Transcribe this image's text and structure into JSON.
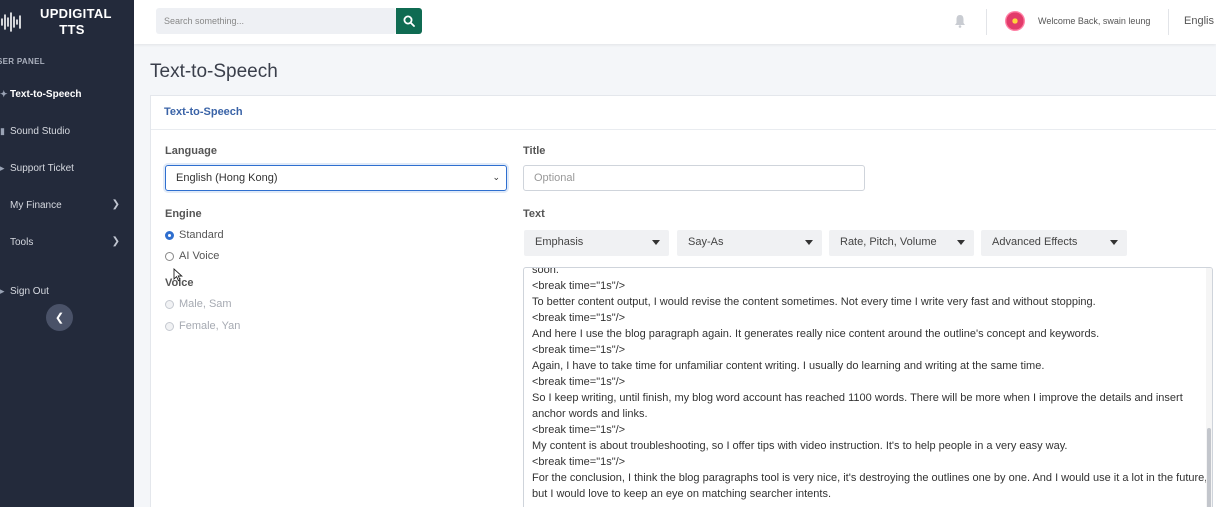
{
  "brand": {
    "line1": "UPDIGITAL",
    "line2": "TTS"
  },
  "sidebar": {
    "panel_label": "SER PANEL",
    "items": [
      {
        "label": "Text-to-Speech",
        "icon": "microphone-icon"
      },
      {
        "label": "Sound Studio",
        "icon": "studio-icon"
      },
      {
        "label": "Support Ticket",
        "icon": "ticket-icon"
      },
      {
        "label": "My Finance",
        "icon": "finance-icon"
      },
      {
        "label": "Tools",
        "icon": "tools-icon"
      },
      {
        "label": "Sign Out",
        "icon": "sign-out-icon"
      }
    ]
  },
  "header": {
    "search_placeholder": "Search something...",
    "welcome": "Welcome Back, swain leung",
    "language": "Englis"
  },
  "page": {
    "title": "Text-to-Speech"
  },
  "card": {
    "title": "Text-to-Speech",
    "language_label": "Language",
    "language_value": "English (Hong Kong)",
    "title_label": "Title",
    "title_placeholder": "Optional",
    "engine_label": "Engine",
    "engine_options": [
      "Standard",
      "AI Voice"
    ],
    "voice_label": "Voice",
    "voice_options": [
      "Male, Sam",
      "Female, Yan"
    ],
    "text_label": "Text",
    "toolbar": [
      "Emphasis",
      "Say-As",
      "Rate, Pitch, Volume",
      "Advanced Effects"
    ],
    "text_lines": [
      "soon.",
      " <break time=\"1s\"/>",
      "To better content output, I would revise the content sometimes. Not every time I write very fast and without stopping.",
      "  <break time=\"1s\"/>",
      "And here I use the blog paragraph again. It generates really nice content around the outline's concept and keywords.",
      "  <break time=\"1s\"/>",
      " Again, I have to take time for unfamiliar content writing. I usually do learning and writing at the same time.",
      "   <break time=\"1s\"/>",
      "So I keep writing, until finish, my blog word account has reached 1100 words. There will be more when I improve the details and insert",
      "anchor words and links.",
      " <break time=\"1s\"/>",
      "My content is about troubleshooting, so I offer tips with video instruction. It's to help people in a very easy way.",
      "  <break time=\"1s\"/>",
      "For the conclusion, I think the blog paragraphs tool is very nice, it's destroying the outlines one by one. And I would use it a lot in the future,",
      "but I would love to keep an eye on matching searcher intents."
    ]
  },
  "colors": {
    "sidebar_bg": "#232a3b",
    "accent": "#0f6b52",
    "link": "#3a63a7"
  }
}
